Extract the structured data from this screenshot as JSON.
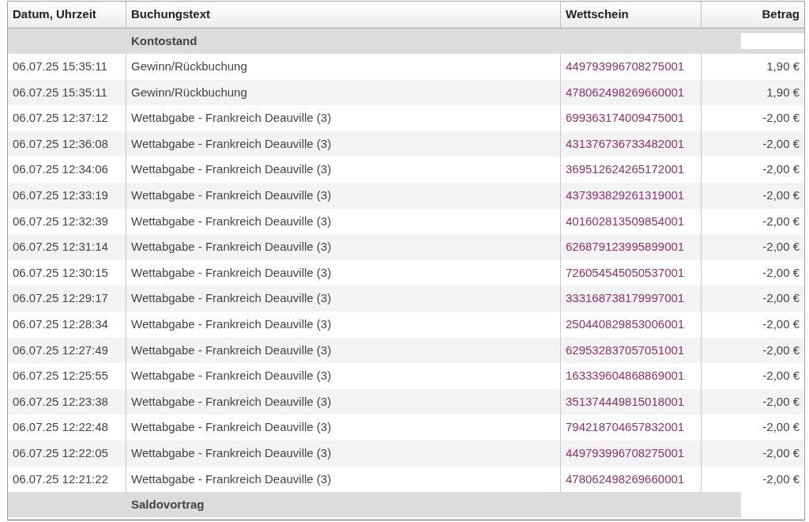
{
  "table": {
    "columns": [
      "Datum, Uhrzeit",
      "Buchungstext",
      "Wettschein",
      "Betrag"
    ],
    "opening_row": {
      "label": "Kontostand"
    },
    "rows": [
      {
        "datetime": "06.07.25 15:35:11",
        "text": "Gewinn/Rückbuchung",
        "ticket": "449793996708275001",
        "amount": "1,90 €"
      },
      {
        "datetime": "06.07.25 15:35:11",
        "text": "Gewinn/Rückbuchung",
        "ticket": "478062498269660001",
        "amount": "1,90 €"
      },
      {
        "datetime": "06.07.25 12:37:12",
        "text": "Wettabgabe - Frankreich Deauville (3)",
        "ticket": "699363174009475001",
        "amount": "-2,00 €"
      },
      {
        "datetime": "06.07.25 12:36:08",
        "text": "Wettabgabe - Frankreich Deauville (3)",
        "ticket": "431376736733482001",
        "amount": "-2,00 €"
      },
      {
        "datetime": "06.07.25 12:34:06",
        "text": "Wettabgabe - Frankreich Deauville (3)",
        "ticket": "369512624265172001",
        "amount": "-2,00 €"
      },
      {
        "datetime": "06.07.25 12:33:19",
        "text": "Wettabgabe - Frankreich Deauville (3)",
        "ticket": "437393829261319001",
        "amount": "-2,00 €"
      },
      {
        "datetime": "06.07.25 12:32:39",
        "text": "Wettabgabe - Frankreich Deauville (3)",
        "ticket": "401602813509854001",
        "amount": "-2,00 €"
      },
      {
        "datetime": "06.07.25 12:31:14",
        "text": "Wettabgabe - Frankreich Deauville (3)",
        "ticket": "626879123995899001",
        "amount": "-2,00 €"
      },
      {
        "datetime": "06.07.25 12:30:15",
        "text": "Wettabgabe - Frankreich Deauville (3)",
        "ticket": "726054545050537001",
        "amount": "-2,00 €"
      },
      {
        "datetime": "06.07.25 12:29:17",
        "text": "Wettabgabe - Frankreich Deauville (3)",
        "ticket": "333168738179997001",
        "amount": "-2,00 €"
      },
      {
        "datetime": "06.07.25 12:28:34",
        "text": "Wettabgabe - Frankreich Deauville (3)",
        "ticket": "250440829853006001",
        "amount": "-2,00 €"
      },
      {
        "datetime": "06.07.25 12:27:49",
        "text": "Wettabgabe - Frankreich Deauville (3)",
        "ticket": "629532837057051001",
        "amount": "-2,00 €"
      },
      {
        "datetime": "06.07.25 12:25:55",
        "text": "Wettabgabe - Frankreich Deauville (3)",
        "ticket": "163339604868869001",
        "amount": "-2,00 €"
      },
      {
        "datetime": "06.07.25 12:23:38",
        "text": "Wettabgabe - Frankreich Deauville (3)",
        "ticket": "351374449815018001",
        "amount": "-2,00 €"
      },
      {
        "datetime": "06.07.25 12:22:48",
        "text": "Wettabgabe - Frankreich Deauville (3)",
        "ticket": "794218704657832001",
        "amount": "-2,00 €"
      },
      {
        "datetime": "06.07.25 12:22:05",
        "text": "Wettabgabe - Frankreich Deauville (3)",
        "ticket": "449793996708275001",
        "amount": "-2,00 €"
      },
      {
        "datetime": "06.07.25 12:21:22",
        "text": "Wettabgabe - Frankreich Deauville (3)",
        "ticket": "478062498269660001",
        "amount": "-2,00 €"
      }
    ],
    "closing_row": {
      "label": "Saldovortrag"
    }
  }
}
